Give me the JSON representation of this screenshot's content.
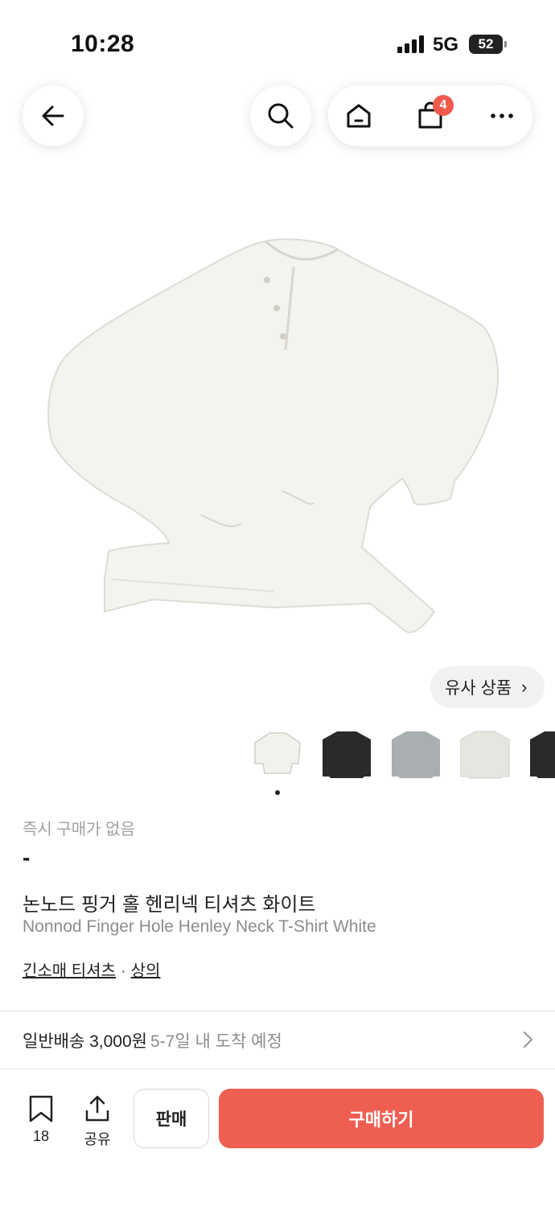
{
  "status_bar": {
    "time": "10:28",
    "network": "5G",
    "battery": "52"
  },
  "nav": {
    "icons": [
      "back-arrow-icon",
      "search-icon",
      "home-icon",
      "shopping-bag-icon",
      "more-icon"
    ],
    "cart_count": "4"
  },
  "gallery": {
    "similar_label": "유사 상품",
    "thumbnail_colors": [
      "white",
      "black",
      "gray",
      "cream",
      "black"
    ]
  },
  "product": {
    "instant_label": "즉시 구매가 없음",
    "price": "-",
    "title_ko": "논노드 핑거 홀 헨리넥 티셔츠 화이트",
    "title_en": "Nonnod Finger Hole Henley Neck T-Shirt White",
    "category_primary": "긴소매 티셔츠",
    "category_separator": "·",
    "category_secondary": "상의"
  },
  "shipping": {
    "label": "일반배송 3,000원",
    "eta": "5-7일 내 도착 예정"
  },
  "bottom_bar": {
    "bookmark_count": "18",
    "share_label": "공유",
    "sell_label": "판매",
    "buy_label": "구매하기",
    "buy_color": "#ef5f51"
  }
}
